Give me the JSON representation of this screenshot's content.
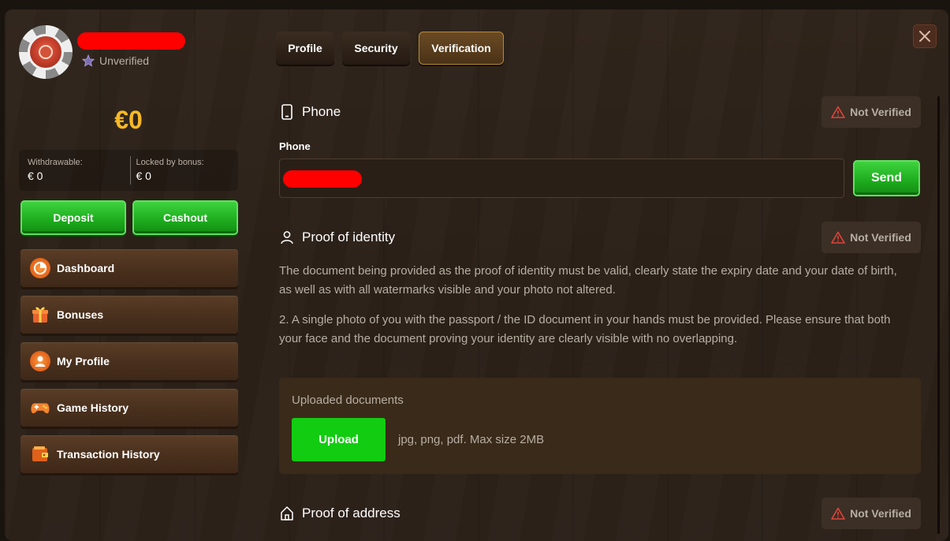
{
  "user": {
    "status": "Unverified"
  },
  "wallet": {
    "balance": "€0",
    "withdrawable_label": "Withdrawable:",
    "withdrawable_value": "€ 0",
    "locked_label": "Locked by bonus:",
    "locked_value": "€ 0"
  },
  "actions": {
    "deposit": "Deposit",
    "cashout": "Cashout"
  },
  "sidebar": {
    "items": [
      {
        "label": "Dashboard",
        "icon": "dashboard-icon"
      },
      {
        "label": "Bonuses",
        "icon": "gift-icon"
      },
      {
        "label": "My Profile",
        "icon": "user-icon"
      },
      {
        "label": "Game History",
        "icon": "gamepad-icon"
      },
      {
        "label": "Transaction History",
        "icon": "wallet-icon"
      }
    ]
  },
  "tabs": [
    {
      "label": "Profile"
    },
    {
      "label": "Security"
    },
    {
      "label": "Verification",
      "active": true
    }
  ],
  "phone_section": {
    "title": "Phone",
    "status": "Not Verified",
    "field_label": "Phone",
    "send": "Send"
  },
  "identity_section": {
    "title": "Proof of identity",
    "status": "Not Verified",
    "paragraph1": "The document being provided as the proof of identity must be valid, clearly state the expiry date and your date of birth, as well as with all watermarks visible and your photo not altered.",
    "paragraph2": "2. A single photo of you with the passport / the ID document in your hands must be provided. Please ensure that both your face and the document proving your identity are clearly visible with no overlapping.",
    "uploaded_title": "Uploaded documents",
    "upload": "Upload",
    "upload_hint": "jpg, png, pdf. Max size 2MB"
  },
  "address_section": {
    "title": "Proof of address",
    "status": "Not Verified"
  },
  "colors": {
    "accent_gold": "#f7b825",
    "green": "#1fae1f",
    "warning_red": "#e0443a"
  }
}
